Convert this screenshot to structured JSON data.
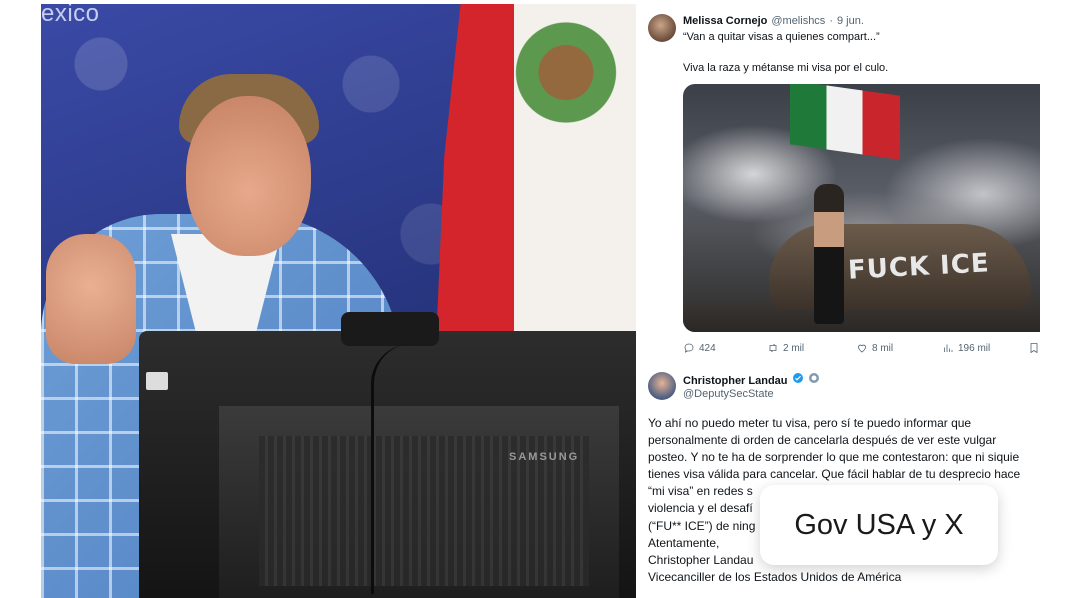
{
  "photo": {
    "backdrop_text": "exico",
    "monitor_brand": "SAMSUNG"
  },
  "tweet1": {
    "author": "Melissa Cornejo",
    "handle": "@melishcs",
    "separator": "·",
    "date": "9 jun.",
    "quoted_text": "“Van a quitar visas a quienes compart...”",
    "body": "Viva la raza y métanse mi visa por el culo.",
    "media_text": "FUCK ICE",
    "stats": {
      "replies": "424",
      "retweets": "2 mil",
      "likes": "8 mil",
      "views": "196 mil"
    }
  },
  "tweet2": {
    "author": "Christopher Landau",
    "handle": "@DeputySecState",
    "body_lines": [
      "Yo ahí no puedo meter tu visa, pero sí te puedo informar que",
      "personalmente di orden de cancelarla después de ver este vulgar",
      "posteo. Y no te ha de sorprender lo que me contestaron: que ni siquie",
      "tienes visa válida para cancelar. Que fácil hablar de tu desprecio hace",
      "“mi visa” en redes s                                               ican la",
      "violencia y el desafí                                              blico",
      "(“FU** ICE”) de ning                                              país.",
      "Atentamente,",
      "Christopher Landau",
      "Vicecanciller de los Estados Unidos de América"
    ]
  },
  "caption": {
    "text": "Gov USA y X"
  },
  "colors": {
    "backdrop_blue": "#2f3c8c",
    "flag_red": "#d4242c",
    "verified_blue": "#1d9bf0",
    "text_primary": "#0f1419",
    "text_secondary": "#536471"
  }
}
